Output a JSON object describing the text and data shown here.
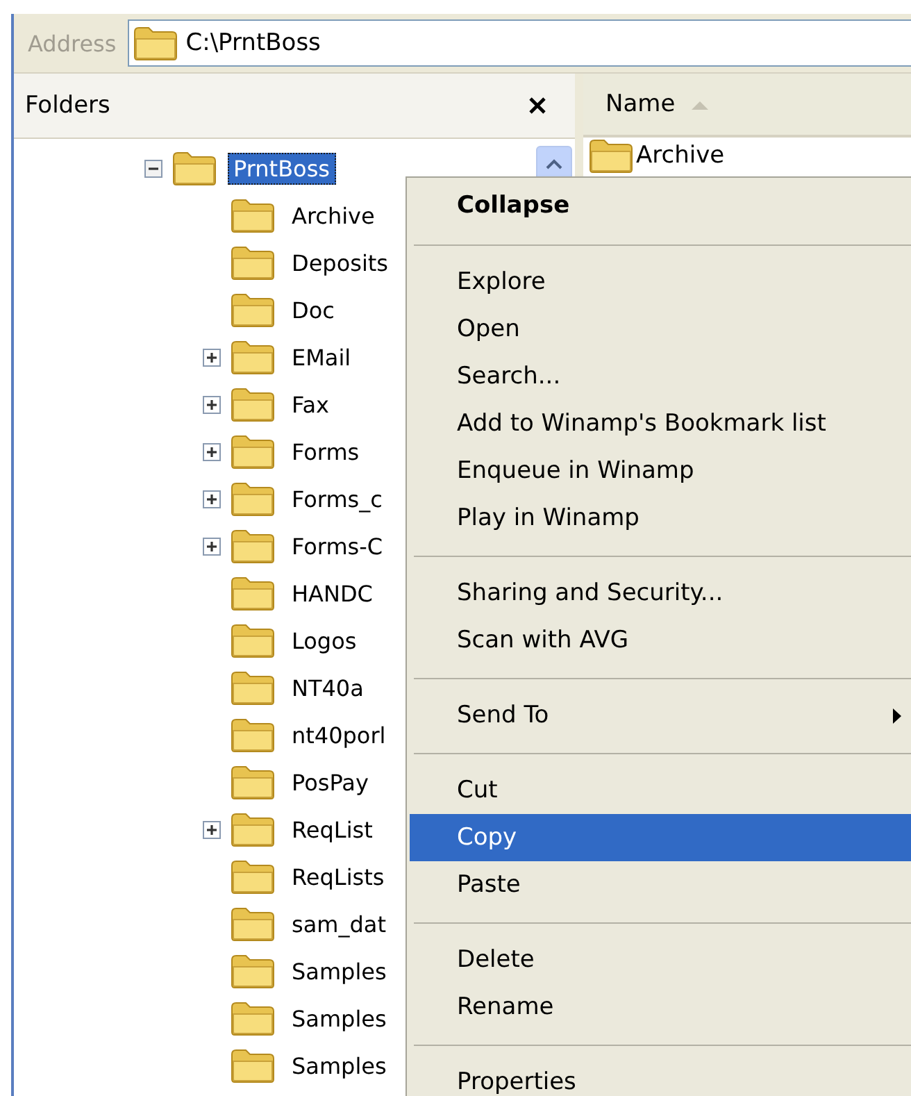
{
  "address": {
    "label": "Address",
    "value": "C:\\PrntBoss"
  },
  "folders_pane": {
    "title": "Folders",
    "tree": [
      {
        "kind": "branch",
        "label": "PrntBoss",
        "expanded": true,
        "selected": true,
        "children": [
          {
            "kind": "leaf",
            "label": "Archive",
            "selected": false
          },
          {
            "kind": "leaf",
            "label": "Deposits",
            "selected": false
          },
          {
            "kind": "leaf",
            "label": "Doc",
            "selected": false
          },
          {
            "kind": "branch",
            "label": "EMail",
            "expanded": false,
            "selected": false
          },
          {
            "kind": "branch",
            "label": "Fax",
            "expanded": false,
            "selected": false
          },
          {
            "kind": "branch",
            "label": "Forms",
            "expanded": false,
            "selected": false
          },
          {
            "kind": "branch",
            "label": "Forms_c",
            "expanded": false,
            "selected": false
          },
          {
            "kind": "branch",
            "label": "Forms-C",
            "expanded": false,
            "selected": false
          },
          {
            "kind": "leaf",
            "label": "HANDC",
            "selected": false
          },
          {
            "kind": "leaf",
            "label": "Logos",
            "selected": false
          },
          {
            "kind": "leaf",
            "label": "NT40a",
            "selected": false
          },
          {
            "kind": "leaf",
            "label": "nt40porl",
            "selected": false
          },
          {
            "kind": "leaf",
            "label": "PosPay",
            "selected": false
          },
          {
            "kind": "branch",
            "label": "ReqList",
            "expanded": false,
            "selected": false
          },
          {
            "kind": "leaf",
            "label": "ReqLists",
            "selected": false
          },
          {
            "kind": "leaf",
            "label": "sam_dat",
            "selected": false
          },
          {
            "kind": "leaf",
            "label": "Samples",
            "selected": false
          },
          {
            "kind": "leaf",
            "label": "Samples",
            "selected": false
          },
          {
            "kind": "leaf",
            "label": "Samples",
            "selected": false
          }
        ]
      }
    ]
  },
  "file_list": {
    "columns": [
      {
        "label": "Name",
        "sorted": true
      }
    ],
    "rows": [
      {
        "name": "Archive"
      }
    ]
  },
  "context_menu": {
    "items": [
      {
        "kind": "item",
        "label": "Collapse",
        "default": true,
        "selected": false,
        "submenu": false
      },
      {
        "kind": "separator"
      },
      {
        "kind": "item",
        "label": "Explore",
        "default": false,
        "selected": false,
        "submenu": false
      },
      {
        "kind": "item",
        "label": "Open",
        "default": false,
        "selected": false,
        "submenu": false
      },
      {
        "kind": "item",
        "label": "Search...",
        "default": false,
        "selected": false,
        "submenu": false
      },
      {
        "kind": "item",
        "label": "Add to Winamp's Bookmark list",
        "default": false,
        "selected": false,
        "submenu": false
      },
      {
        "kind": "item",
        "label": "Enqueue in Winamp",
        "default": false,
        "selected": false,
        "submenu": false
      },
      {
        "kind": "item",
        "label": "Play in Winamp",
        "default": false,
        "selected": false,
        "submenu": false
      },
      {
        "kind": "separator"
      },
      {
        "kind": "item",
        "label": "Sharing and Security...",
        "default": false,
        "selected": false,
        "submenu": false
      },
      {
        "kind": "item",
        "label": "Scan with AVG",
        "default": false,
        "selected": false,
        "submenu": false
      },
      {
        "kind": "separator"
      },
      {
        "kind": "item",
        "label": "Send To",
        "default": false,
        "selected": false,
        "submenu": true
      },
      {
        "kind": "separator"
      },
      {
        "kind": "item",
        "label": "Cut",
        "default": false,
        "selected": false,
        "submenu": false
      },
      {
        "kind": "item",
        "label": "Copy",
        "default": false,
        "selected": true,
        "submenu": false
      },
      {
        "kind": "item",
        "label": "Paste",
        "default": false,
        "selected": false,
        "submenu": false
      },
      {
        "kind": "separator"
      },
      {
        "kind": "item",
        "label": "Delete",
        "default": false,
        "selected": false,
        "submenu": false
      },
      {
        "kind": "item",
        "label": "Rename",
        "default": false,
        "selected": false,
        "submenu": false
      },
      {
        "kind": "separator"
      },
      {
        "kind": "item",
        "label": "Properties",
        "default": false,
        "selected": false,
        "submenu": false
      }
    ]
  }
}
